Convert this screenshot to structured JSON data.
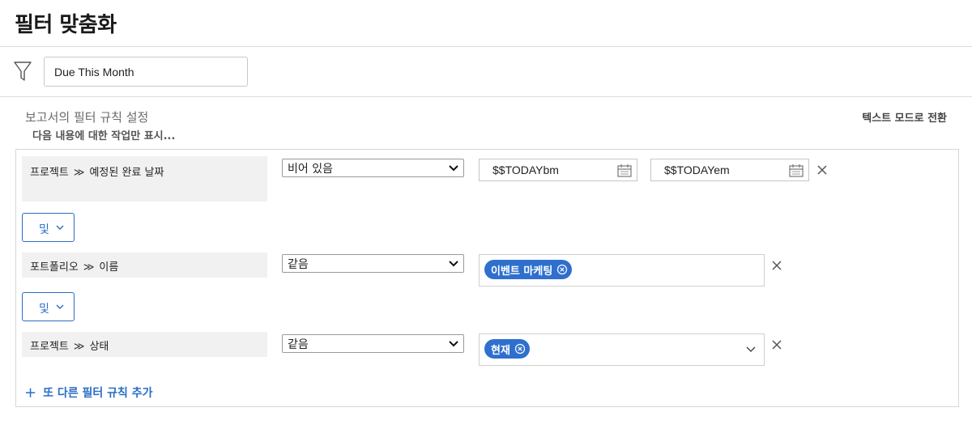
{
  "header": {
    "title": "필터 맞춤화"
  },
  "filter_name": {
    "value": "Due This Month",
    "icon": "funnel-icon"
  },
  "section": {
    "title": "보고서의 필터 규칙 설정",
    "subtitle": "다음 내용에 대한 작업만 표시...",
    "text_mode_label": "텍스트 모드로 전환"
  },
  "rules": [
    {
      "object": "프로젝트",
      "separator": "≫",
      "field": "예정된 완료 날짜",
      "operator": "비어 있음",
      "values": [
        "$$TODAYbm",
        "$$TODAYem"
      ]
    },
    {
      "object": "포트폴리오",
      "separator": "≫",
      "field": "이름",
      "operator": "같음",
      "tags": [
        "이벤트 마케팅"
      ]
    },
    {
      "object": "프로젝트",
      "separator": "≫",
      "field": "상태",
      "operator": "같음",
      "tags": [
        "현재"
      ]
    }
  ],
  "connectors": [
    "및",
    "및"
  ],
  "add_rule_label": "또 다른 필터 규칙 추가",
  "colors": {
    "accent": "#2a6ec6",
    "pill": "#2f6fce",
    "field_bg": "#f1f1f1"
  }
}
